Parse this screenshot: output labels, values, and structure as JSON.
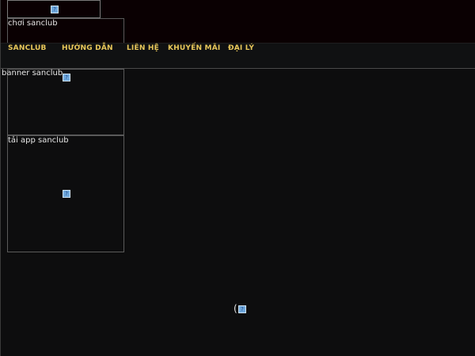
{
  "header": {
    "logo": {
      "icon": "broken-image-icon"
    }
  },
  "nav": {
    "items": [
      {
        "label": "SANCLUB"
      },
      {
        "label": "HƯỚNG DẪN"
      },
      {
        "label": "LIÊN HỆ"
      },
      {
        "label": "KHUYẾN MÃI"
      },
      {
        "label": "ĐẠI LÝ"
      }
    ]
  },
  "images": {
    "play_alt": "chơi sanclub",
    "banner_alt": "banner sanclub",
    "app_alt": "tải app sanclub"
  },
  "misc": {
    "paren": "("
  },
  "colors": {
    "background": "#0d0d0e",
    "nav_text": "#e8c75a",
    "top_bar": "#0a0002"
  }
}
